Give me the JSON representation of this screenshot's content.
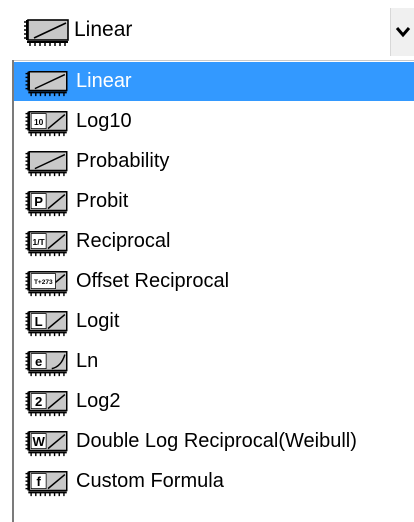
{
  "selector": {
    "selected_label": "Linear",
    "selected_icon": "linear-scale-icon",
    "dropdown_icon": "chevron-down-icon"
  },
  "options": [
    {
      "label": "Linear",
      "icon": "linear-scale-icon",
      "icon_text": "",
      "selected": true
    },
    {
      "label": "Log10",
      "icon": "log10-scale-icon",
      "icon_text": "10",
      "selected": false
    },
    {
      "label": "Probability",
      "icon": "probability-scale-icon",
      "icon_text": "",
      "selected": false
    },
    {
      "label": "Probit",
      "icon": "probit-scale-icon",
      "icon_text": "P",
      "selected": false
    },
    {
      "label": "Reciprocal",
      "icon": "reciprocal-scale-icon",
      "icon_text": "1/T",
      "selected": false
    },
    {
      "label": "Offset Reciprocal",
      "icon": "offset-reciprocal-scale-icon",
      "icon_text": "T+273",
      "selected": false
    },
    {
      "label": "Logit",
      "icon": "logit-scale-icon",
      "icon_text": "L",
      "selected": false
    },
    {
      "label": "Ln",
      "icon": "ln-scale-icon",
      "icon_text": "e",
      "selected": false
    },
    {
      "label": "Log2",
      "icon": "log2-scale-icon",
      "icon_text": "2",
      "selected": false
    },
    {
      "label": "Double Log Reciprocal(Weibull)",
      "icon": "weibull-scale-icon",
      "icon_text": "W",
      "selected": false
    },
    {
      "label": "Custom Formula",
      "icon": "custom-formula-icon",
      "icon_text": "f",
      "selected": false
    }
  ],
  "colors": {
    "selection": "#3399ff",
    "selected_text": "#ffffff",
    "text": "#000000"
  }
}
